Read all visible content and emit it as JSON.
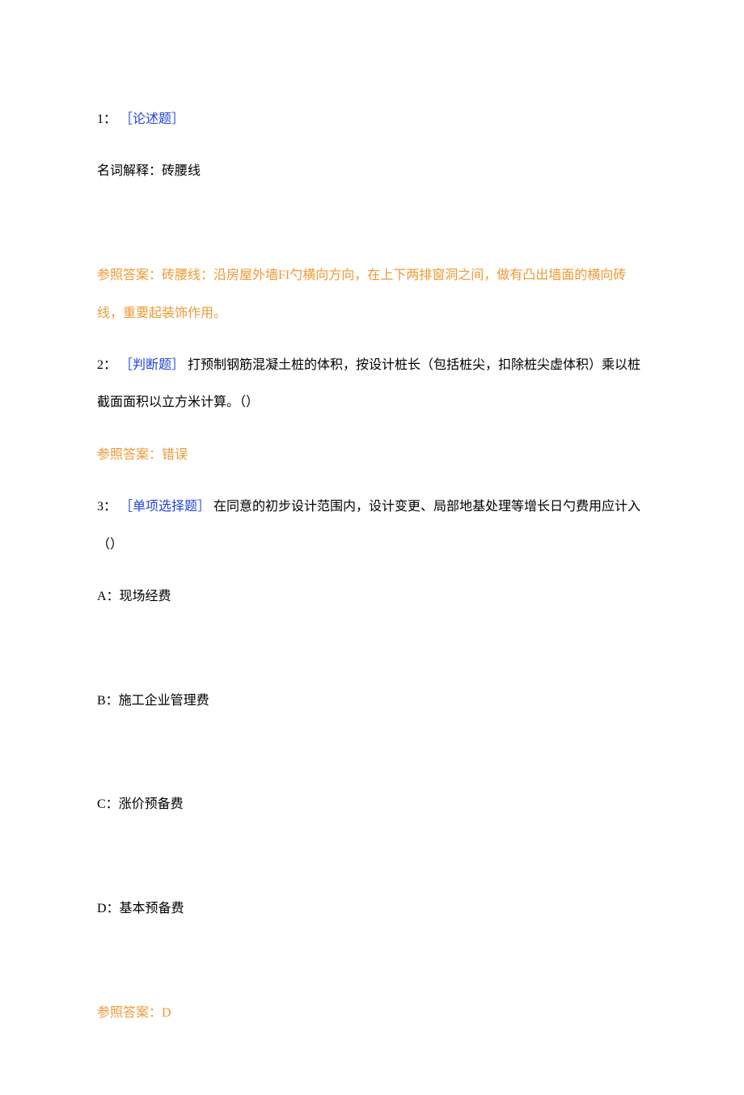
{
  "q1": {
    "num": "1：",
    "tag": "［论述题］",
    "body": "名词解释：砖腰线",
    "answer": "参照答案：砖腰线：沿房屋外墙FI勺横向方向，在上下两排窗洞之间，做有凸出墙面的横向砖线，重要起装饰作用。"
  },
  "q2": {
    "num": "2：",
    "tag": "［判断题］",
    "body": "打预制钢筋混凝土桩的体积，按设计桩长（包括桩尖，扣除桩尖虚体积）乘以桩截面面积以立方米计算。（）",
    "answer": "参照答案：错误"
  },
  "q3": {
    "num": "3：",
    "tag": "［单项选择题］",
    "body": "在同意的初步设计范围内，设计变更、局部地基处理等增长日勺费用应计入（）",
    "optA": "A：现场经费",
    "optB": "B：施工企业管理费",
    "optC": "C：涨价预备费",
    "optD": "D：基本预备费",
    "answer": "参照答案：D"
  }
}
